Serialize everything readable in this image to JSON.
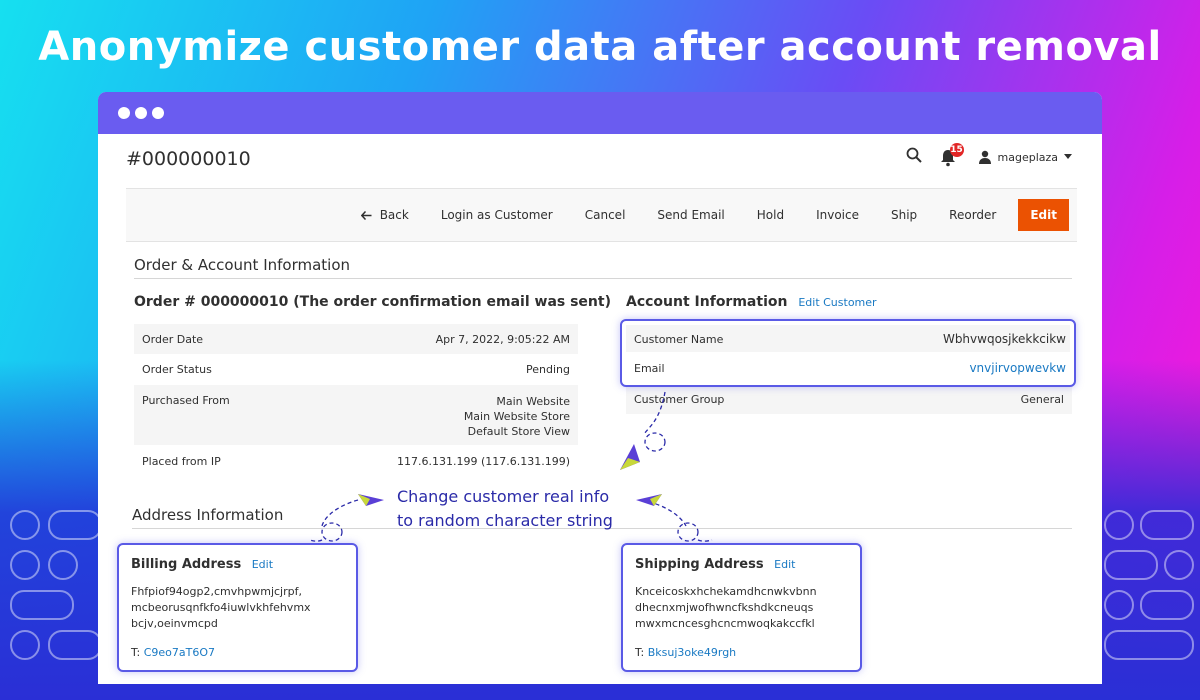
{
  "hero_title": "Anonymize customer data after account removal",
  "header": {
    "order_id": "#000000010",
    "notification_count": "15",
    "username": "mageplaza"
  },
  "actions": {
    "back": "Back",
    "login_as_customer": "Login as Customer",
    "cancel": "Cancel",
    "send_email": "Send Email",
    "hold": "Hold",
    "invoice": "Invoice",
    "ship": "Ship",
    "reorder": "Reorder",
    "edit": "Edit"
  },
  "order_account": {
    "section_title": "Order & Account Information",
    "order_title": "Order # 000000010 (The order confirmation email was sent)",
    "order_rows": [
      {
        "label": "Order Date",
        "value": "Apr 7, 2022, 9:05:22 AM"
      },
      {
        "label": "Order Status",
        "value": "Pending"
      },
      {
        "label": "Purchased From",
        "value_lines": [
          "Main Website",
          "Main Website Store",
          "Default Store View"
        ]
      },
      {
        "label": "Placed from IP",
        "value": "117.6.131.199 (117.6.131.199)"
      }
    ],
    "account_title": "Account Information",
    "edit_customer": "Edit Customer",
    "account_rows": [
      {
        "label": "Customer Name",
        "value": "Wbhvwqosjkekkcikw"
      },
      {
        "label": "Email",
        "value": "vnvjirvopwevkw"
      },
      {
        "label": "Customer Group",
        "value": "General"
      }
    ]
  },
  "callout": {
    "line1": "Change customer real info",
    "line2": "to random character string"
  },
  "address": {
    "section_title": "Address Information",
    "billing": {
      "title": "Billing Address",
      "edit": "Edit",
      "lines": [
        "Fhfpiof94ogp2,cmvhpwmjcjrpf,",
        "mcbeorusqnfkfo4iuwlvkhfehvmx",
        "bcjv,oeinvmcpd"
      ],
      "phone_label": "T:",
      "phone": "C9eo7aT6O7"
    },
    "shipping": {
      "title": "Shipping Address",
      "edit": "Edit",
      "lines": [
        "Knceicoskxhchekamdhcnwkvbnn",
        "dhecnxmjwofhwncfkshdkcneuqs",
        "mwxmcncesghcncmwoqkakccfkl"
      ],
      "phone_label": "T:",
      "phone": "Bksuj3oke49rgh"
    }
  },
  "colors": {
    "accent_edit": "#eb5202",
    "link": "#1979c3",
    "highlight": "#5a5ae6",
    "titlebar": "#6a5cf0"
  }
}
